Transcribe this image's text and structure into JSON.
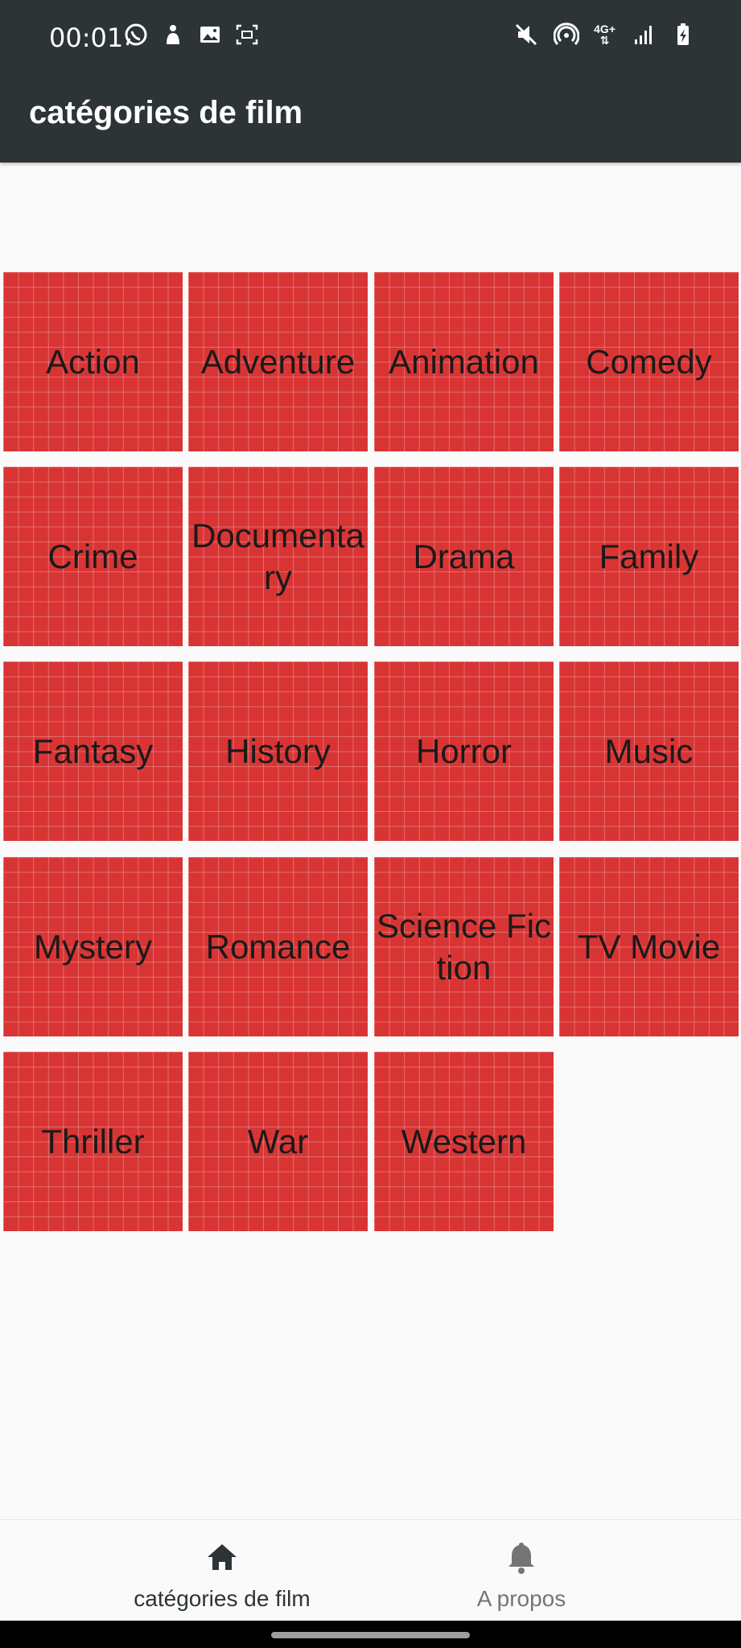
{
  "status_bar": {
    "time": "00:01",
    "left_icons": [
      "whatsapp-icon",
      "notification-icon",
      "image-icon",
      "screenshot-icon"
    ],
    "right_icons": [
      "mute-icon",
      "hotspot-icon",
      "network-4g-icon",
      "signal-icon",
      "battery-charging-icon"
    ],
    "network_label": "4G+"
  },
  "app_bar": {
    "title": "catégories de film",
    "background": "#2d3436"
  },
  "categories": [
    {
      "label": "Action"
    },
    {
      "label": "Adventure"
    },
    {
      "label": "Animation"
    },
    {
      "label": "Comedy"
    },
    {
      "label": "Crime"
    },
    {
      "label": "Documentary"
    },
    {
      "label": "Drama"
    },
    {
      "label": "Family"
    },
    {
      "label": "Fantasy"
    },
    {
      "label": "History"
    },
    {
      "label": "Horror"
    },
    {
      "label": "Music"
    },
    {
      "label": "Mystery"
    },
    {
      "label": "Romance"
    },
    {
      "label": "Science Fiction"
    },
    {
      "label": "TV Movie"
    },
    {
      "label": "Thriller"
    },
    {
      "label": "War"
    },
    {
      "label": "Western"
    }
  ],
  "tile_color": "#d93434",
  "bottom_nav": {
    "items": [
      {
        "label": "catégories de film",
        "icon": "home-icon",
        "active": true,
        "color": "#2d3436"
      },
      {
        "label": "A propos",
        "icon": "bell-icon",
        "active": false,
        "color": "#757575"
      }
    ]
  }
}
